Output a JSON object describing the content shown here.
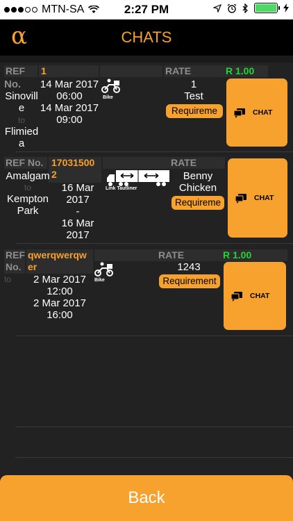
{
  "status_bar": {
    "carrier": "MTN-SA",
    "time": "2:27 PM"
  },
  "nav": {
    "logo": "α",
    "title": "CHATS"
  },
  "cards": [
    {
      "ref_label": "REF",
      "no_label": "No.",
      "ref_value": "1",
      "rate_label": "RATE",
      "rate_value": "R 1.00",
      "from": "Sinovill\ne",
      "to_label": "to",
      "to": "Flimied\na",
      "pickup_date": "14 Mar 2017",
      "pickup_time": "06:00",
      "delivery_date": "14 Mar 2017",
      "delivery_time": "09:00",
      "vehicle": "Bike",
      "description": "1\nTest",
      "requirement_label": "Requireme",
      "chat_label": "CHAT"
    },
    {
      "ref_label": "REF",
      "no_label": "No.",
      "ref_value": "17031500\n2",
      "rate_label": "RATE",
      "from": "Amalgam",
      "to_label": "to",
      "to": "Kempton\nPark",
      "dates": "16 Mar\n2017\n-\n16 Mar\n2017",
      "vehicle": "Link Tautliner",
      "description": "Benny\nChicken",
      "requirement_label": "Requireme",
      "chat_label": "CHAT"
    },
    {
      "ref_label": "REF",
      "no_label": "No.",
      "ref_value": "qwerqwerqw\ner",
      "rate_label": "RATE",
      "rate_value": "R 1.00",
      "to_label": "to",
      "pickup_date": "2 Mar 2017",
      "pickup_time": "12:00",
      "delivery_date": "2 Mar 2017",
      "delivery_time": "16:00",
      "vehicle": "Bike",
      "description": "1243",
      "requirement_label": "Requirement",
      "chat_label": "CHAT"
    }
  ],
  "back_label": "Back",
  "colors": {
    "accent": "#f7a12e",
    "rate_green": "#22d33a",
    "background": "#222222"
  }
}
